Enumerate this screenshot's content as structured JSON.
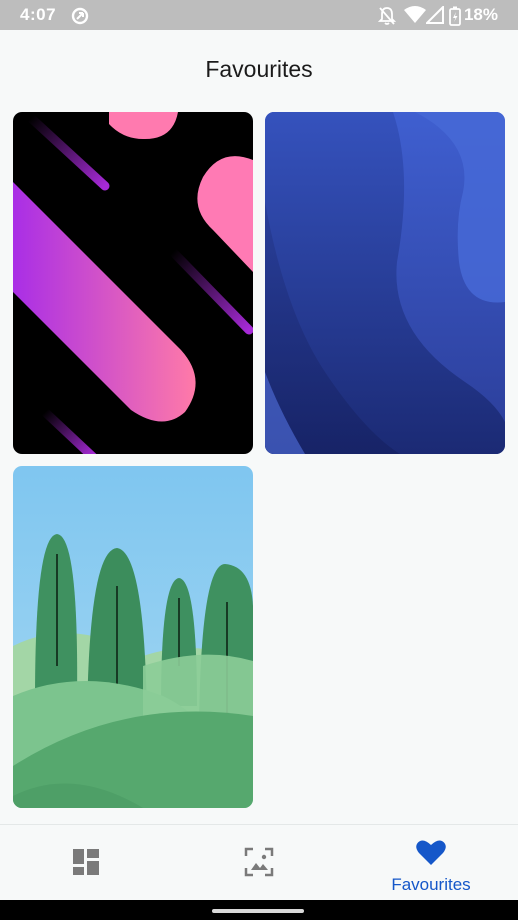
{
  "status_bar": {
    "time": "4:07",
    "battery": "18%",
    "icons": [
      "data-saver-icon",
      "notifications-off-icon",
      "wifi-icon",
      "signal-icon",
      "battery-charging-icon"
    ]
  },
  "app_bar": {
    "title": "Favourites"
  },
  "wallpapers": [
    {
      "name": "pink-purple-diagonal-stripes",
      "colors": [
        "#000000",
        "#b02ee0",
        "#ff7ab0"
      ]
    },
    {
      "name": "blue-waves",
      "colors": [
        "#3f5fcf",
        "#1a2a70"
      ]
    },
    {
      "name": "green-hills-trees",
      "colors": [
        "#8fcaf2",
        "#3f8f5c",
        "#5fb37a"
      ]
    }
  ],
  "bottom_nav": {
    "items": [
      {
        "icon": "dashboard-icon",
        "label": ""
      },
      {
        "icon": "wallpaper-icon",
        "label": ""
      },
      {
        "icon": "heart-icon",
        "label": "Favourites",
        "selected": true
      }
    ],
    "accent": "#1557c9",
    "inactive": "#7a7a7a"
  }
}
